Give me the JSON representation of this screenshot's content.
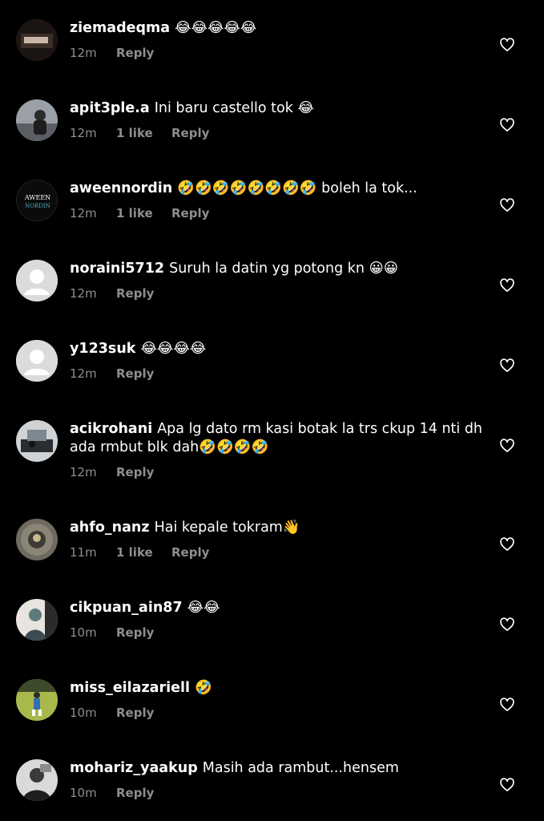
{
  "comments": [
    {
      "username": "ziemadeqma",
      "text": "😂😂😂😂😂",
      "time": "12m",
      "likes": "",
      "reply": "Reply",
      "avatar": "avatar-dark-photo"
    },
    {
      "username": "apit3ple.a",
      "text": "Ini baru castello tok 😂",
      "time": "12m",
      "likes": "1 like",
      "reply": "Reply",
      "avatar": "avatar-person-photo"
    },
    {
      "username": "aweennordin",
      "text": "🤣🤣🤣🤣🤣🤣🤣🤣 boleh la tok...",
      "time": "12m",
      "likes": "1 like",
      "reply": "Reply",
      "avatar": "avatar-logo",
      "avatar_text_top": "AWEEN",
      "avatar_text_bottom": "NORDIN"
    },
    {
      "username": "noraini5712",
      "text": "Suruh la datin yg potong kn 😀😀",
      "time": "12m",
      "likes": "",
      "reply": "Reply",
      "avatar": "avatar-default"
    },
    {
      "username": "y123suk",
      "text": "😂😂😂😂",
      "time": "12m",
      "likes": "",
      "reply": "Reply",
      "avatar": "avatar-default"
    },
    {
      "username": "acikrohani",
      "text": "Apa lg dato rm kasi botak la trs ckup 14 nti dh ada rmbut blk dah🤣🤣🤣🤣",
      "time": "12m",
      "likes": "",
      "reply": "Reply",
      "avatar": "avatar-room-photo"
    },
    {
      "username": "ahfo_nanz",
      "text": "Hai kepale tokram👋",
      "time": "11m",
      "likes": "1 like",
      "reply": "Reply",
      "avatar": "avatar-emblem-photo"
    },
    {
      "username": "cikpuan_ain87",
      "text": "😂😂",
      "time": "10m",
      "likes": "",
      "reply": "Reply",
      "avatar": "avatar-person-photo"
    },
    {
      "username": "miss_eilazariell",
      "text": "🤣",
      "time": "10m",
      "likes": "",
      "reply": "Reply",
      "avatar": "avatar-field-photo"
    },
    {
      "username": "mohariz_yaakup",
      "text": "Masih ada rambut...hensem",
      "time": "10m",
      "likes": "",
      "reply": "Reply",
      "avatar": "avatar-man-photo"
    }
  ],
  "colors": {
    "background": "#000000",
    "text": "#ffffff",
    "secondary": "#8e8e8e",
    "default_avatar": "#dbdbdb"
  }
}
